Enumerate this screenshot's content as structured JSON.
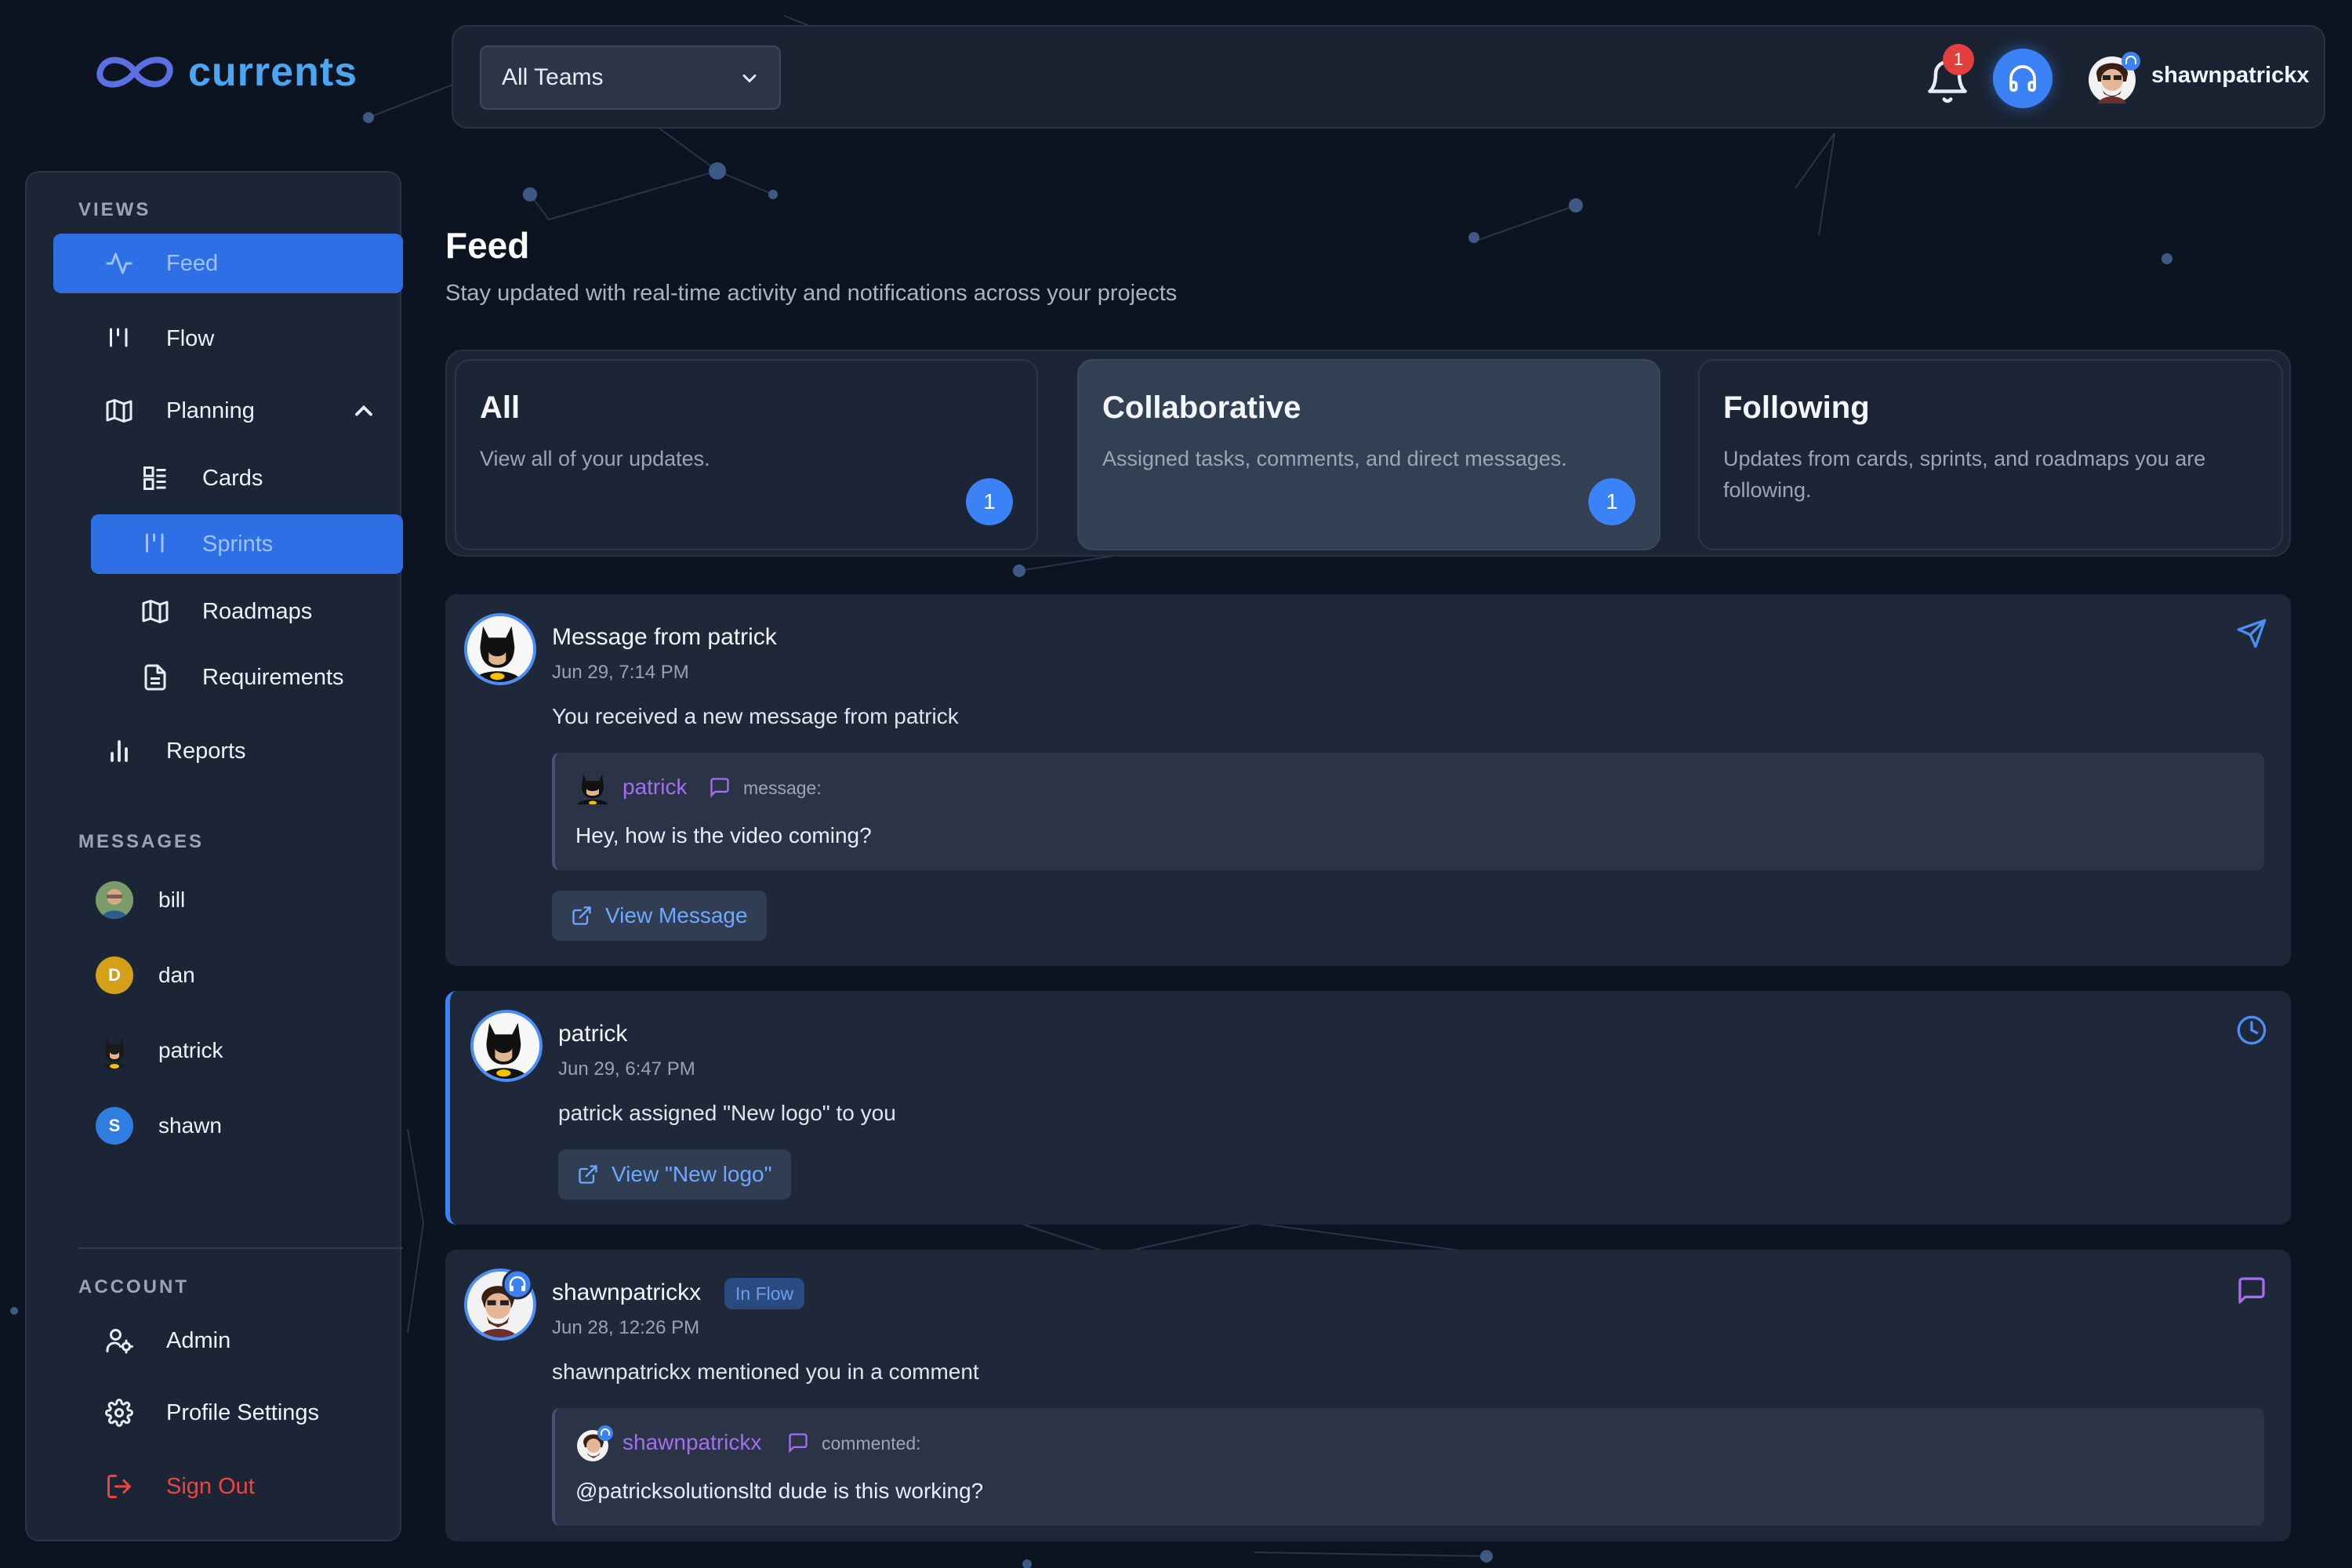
{
  "app": {
    "logo_text": "currents"
  },
  "sidebar": {
    "views_label": "VIEWS",
    "items": [
      {
        "label": "Feed",
        "icon": "activity-icon",
        "active": true
      },
      {
        "label": "Flow",
        "icon": "flow-icon"
      },
      {
        "label": "Planning",
        "icon": "map-icon",
        "expanded": true
      },
      {
        "label": "Reports",
        "icon": "bar-chart-icon"
      }
    ],
    "planning_children": [
      {
        "label": "Cards",
        "icon": "cards-icon"
      },
      {
        "label": "Sprints",
        "icon": "sprints-icon",
        "active": true
      },
      {
        "label": "Roadmaps",
        "icon": "map-icon"
      },
      {
        "label": "Requirements",
        "icon": "document-icon"
      }
    ],
    "messages_label": "MESSAGES",
    "messages": [
      {
        "name": "bill",
        "avatar": "photo"
      },
      {
        "name": "dan",
        "initial": "D",
        "color": "#d4a017"
      },
      {
        "name": "patrick",
        "avatar": "batman"
      },
      {
        "name": "shawn",
        "initial": "S",
        "color": "#2f7de1"
      }
    ],
    "account_label": "ACCOUNT",
    "account": [
      {
        "label": "Admin",
        "icon": "user-gear-icon"
      },
      {
        "label": "Profile Settings",
        "icon": "gear-icon"
      },
      {
        "label": "Sign Out",
        "icon": "sign-out-icon",
        "color": "#ef4444"
      }
    ]
  },
  "topbar": {
    "team_select": "All Teams",
    "notification_count": "1",
    "username": "shawnpatrickx"
  },
  "page": {
    "title": "Feed",
    "subtitle": "Stay updated with real-time activity and notifications across your projects"
  },
  "filters": [
    {
      "title": "All",
      "description": "View all of your updates.",
      "count": "1"
    },
    {
      "title": "Collaborative",
      "description": "Assigned tasks, comments, and direct messages.",
      "count": "1",
      "selected": true
    },
    {
      "title": "Following",
      "description": "Updates from cards, sprints, and roadmaps you are following."
    }
  ],
  "feed": [
    {
      "title": "Message from patrick",
      "time": "Jun 29, 7:14 PM",
      "text": "You received a new message from patrick",
      "quote": {
        "name": "patrick",
        "kind": "message:",
        "text": "Hey, how is the video coming?"
      },
      "action": "View Message",
      "type_icon": "send-icon"
    },
    {
      "title": "patrick",
      "time": "Jun 29, 6:47 PM",
      "text": "patrick assigned \"New logo\" to you",
      "action": "View \"New logo\"",
      "type_icon": "clock-icon"
    },
    {
      "title": "shawnpatrickx",
      "status": "In Flow",
      "time": "Jun 28, 12:26 PM",
      "text": "shawnpatrickx mentioned you in a comment",
      "quote": {
        "name": "shawnpatrickx",
        "kind": "commented:",
        "text": "@patricksolutionsltd dude is this working?"
      },
      "type_icon": "comment-icon"
    }
  ],
  "colors": {
    "accent": "#3b82f6",
    "background": "#0d1421",
    "panel": "#1e2838",
    "danger": "#ef4444",
    "mention": "#a46ef0"
  }
}
